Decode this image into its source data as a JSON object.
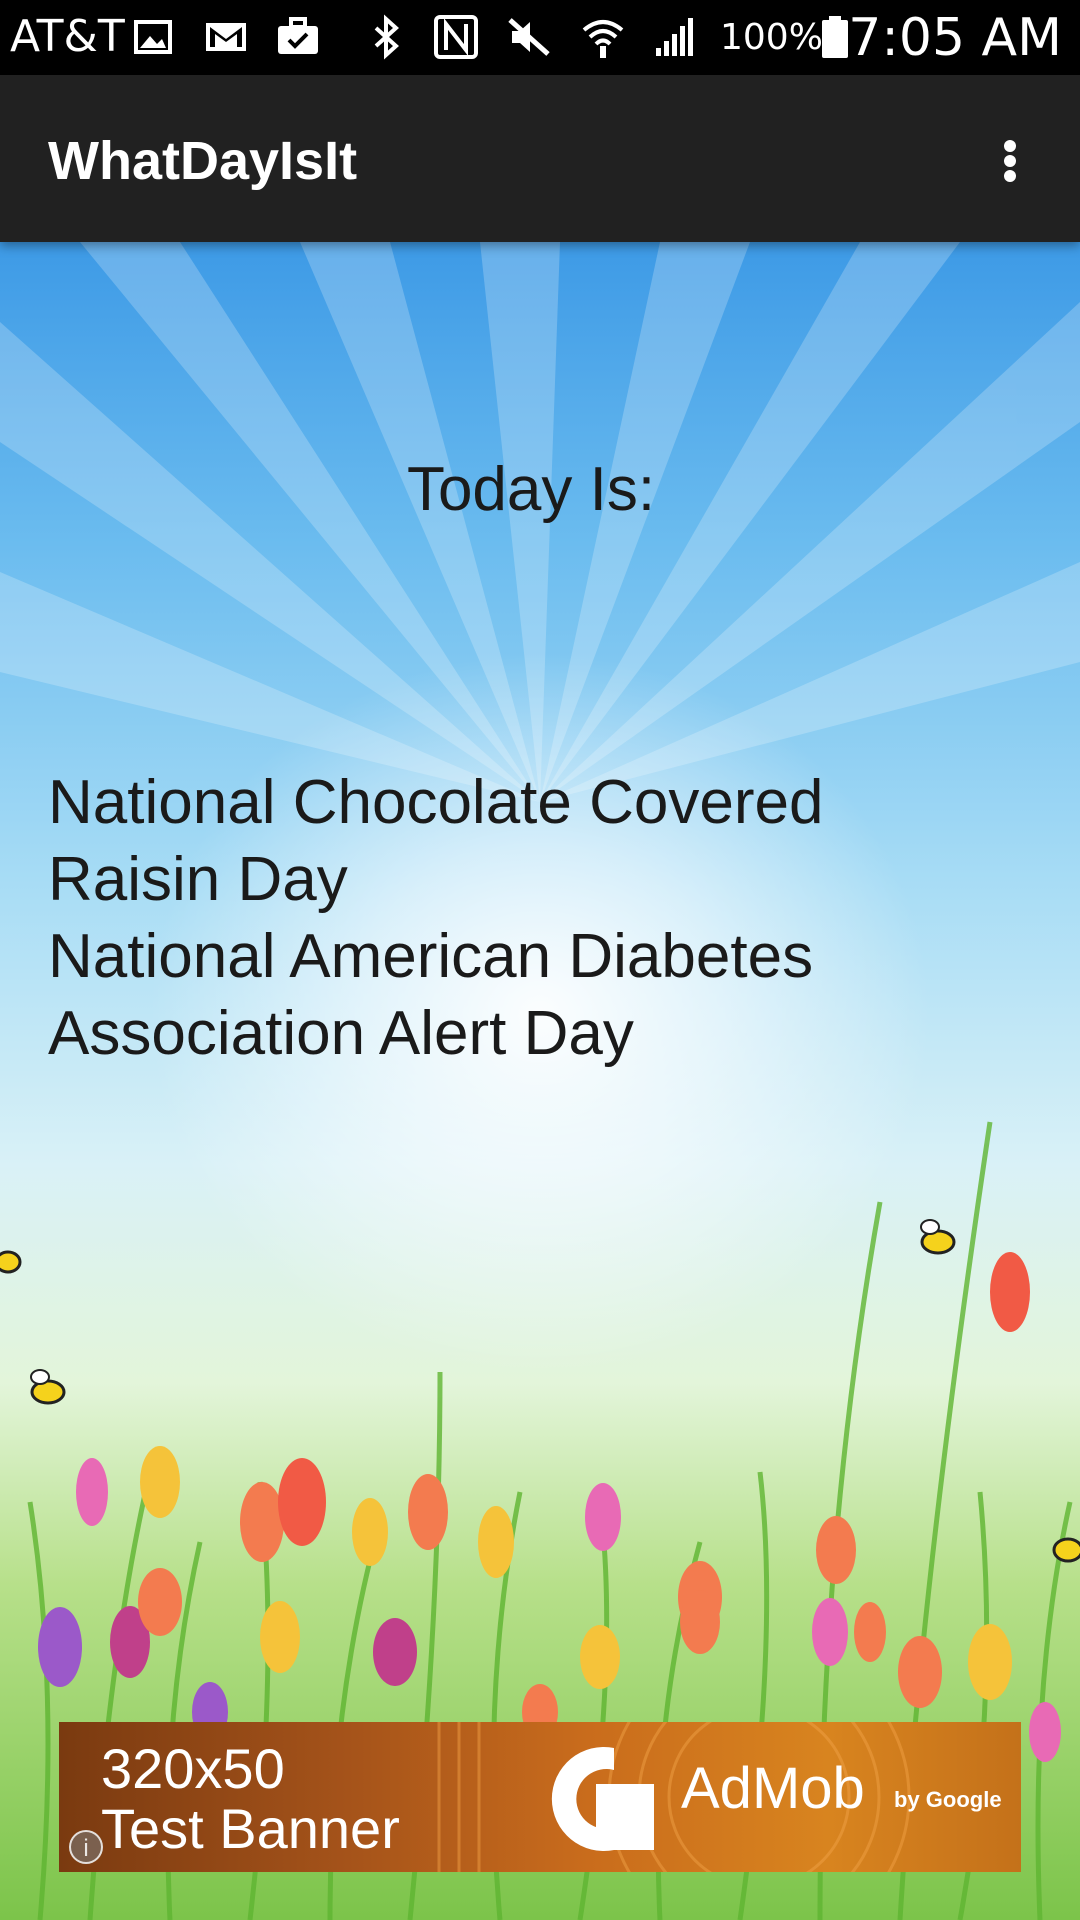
{
  "status_bar": {
    "carrier": "AT&T",
    "battery_percent": "100%",
    "time": "7:05 AM",
    "icons": [
      "image-icon",
      "gmail-icon",
      "briefcase-icon",
      "bluetooth-icon",
      "nfc-icon",
      "mute-icon",
      "wifi-icon",
      "signal-icon",
      "battery-icon"
    ]
  },
  "app_bar": {
    "title": "WhatDayIsIt",
    "menu_icon": "overflow-menu-icon"
  },
  "main": {
    "today_label": "Today Is:",
    "days": [
      "National Chocolate Covered Raisin Day",
      "National American Diabetes Association Alert Day"
    ]
  },
  "ad": {
    "size_text": "320x50",
    "test_text": "Test Banner",
    "brand": "AdMob",
    "by": "by Google",
    "info": "i"
  },
  "colors": {
    "status_bar": "#000000",
    "app_bar": "#212121",
    "text": "#1a1a1a",
    "sky_top": "#3d9ae6",
    "grass": "#7cc44a",
    "ad_orange": "#d8841f"
  }
}
